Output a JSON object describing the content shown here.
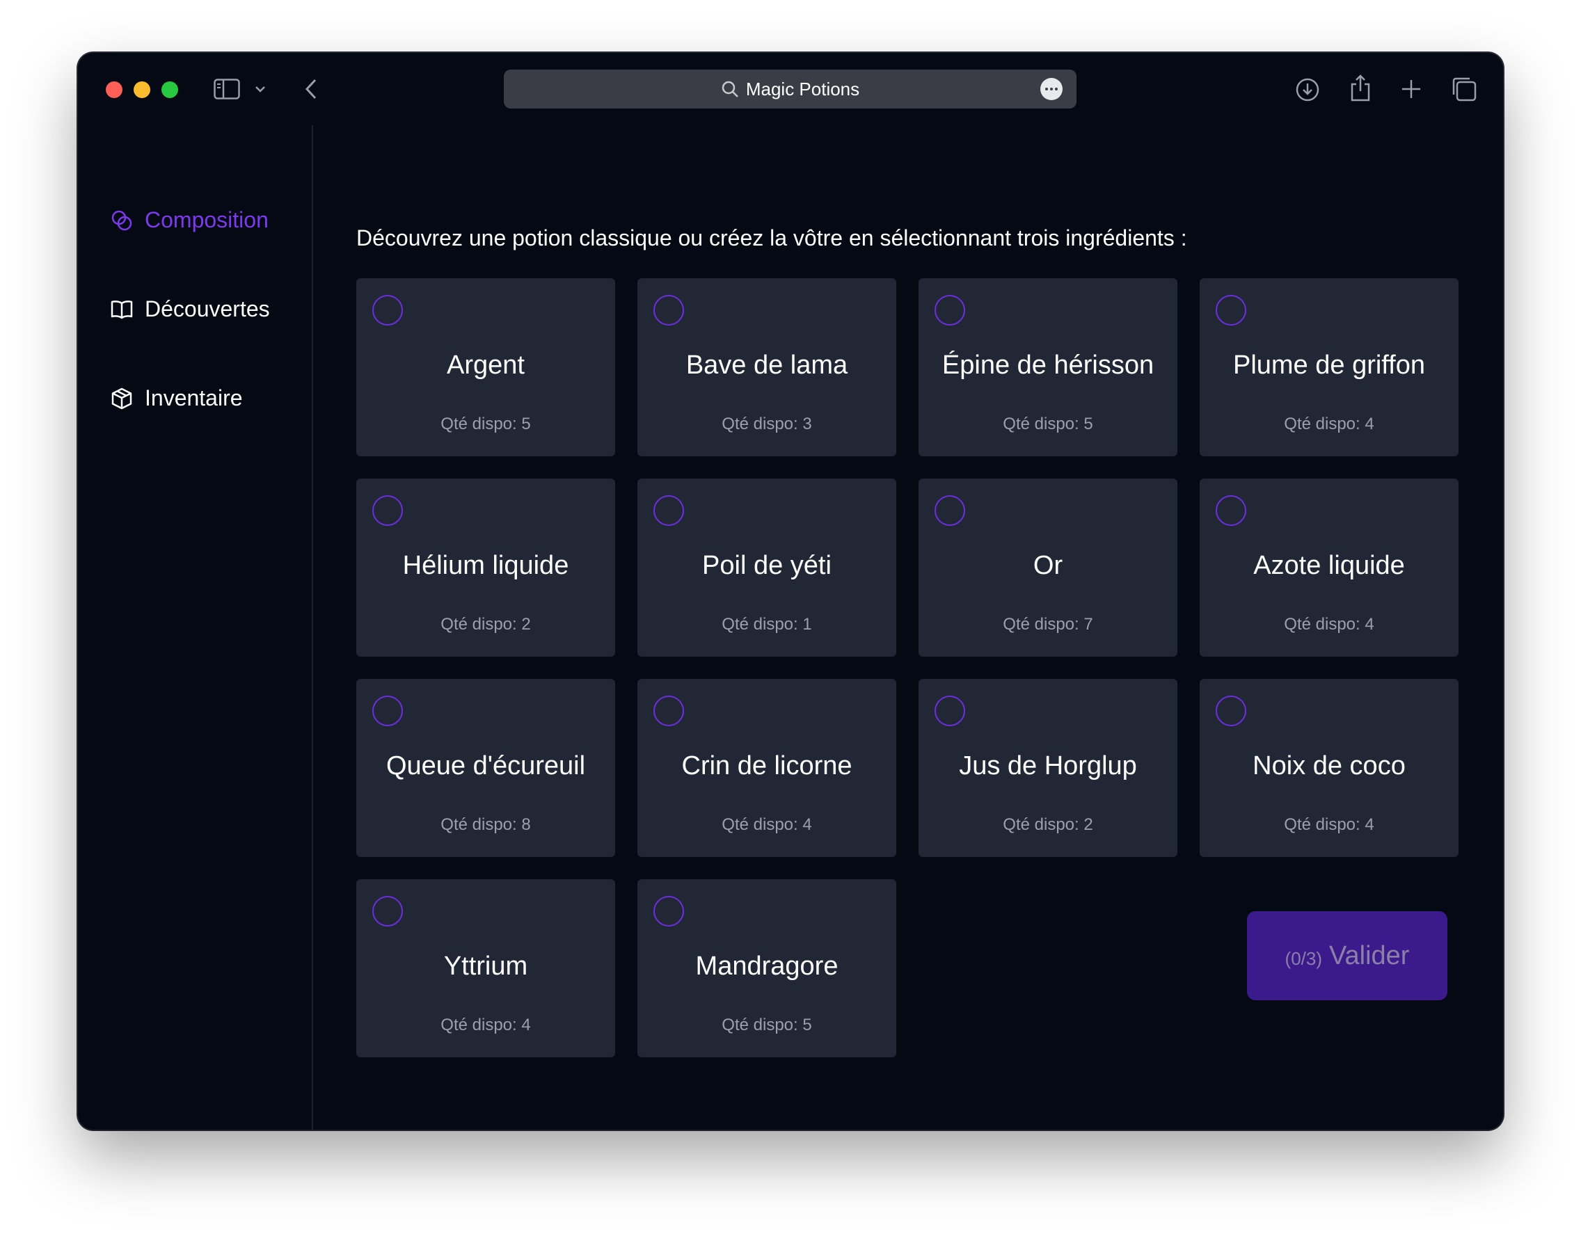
{
  "window": {
    "title": "Magic Potions"
  },
  "sidebar": {
    "items": [
      {
        "label": "Composition",
        "icon": "composition-icon",
        "active": true
      },
      {
        "label": "Découvertes",
        "icon": "book-icon",
        "active": false
      },
      {
        "label": "Inventaire",
        "icon": "box-icon",
        "active": false
      }
    ]
  },
  "main": {
    "intro": "Découvrez une potion classique ou créez la vôtre en sélectionnant trois ingrédients :",
    "ingredients": [
      {
        "name": "Argent",
        "qty": "Qté dispo: 5"
      },
      {
        "name": "Bave de lama",
        "qty": "Qté dispo: 3"
      },
      {
        "name": "Épine de hérisson",
        "qty": "Qté dispo: 5"
      },
      {
        "name": "Plume de griffon",
        "qty": "Qté dispo: 4"
      },
      {
        "name": "Hélium liquide",
        "qty": "Qté dispo: 2"
      },
      {
        "name": "Poil de yéti",
        "qty": "Qté dispo: 1"
      },
      {
        "name": "Or",
        "qty": "Qté dispo: 7"
      },
      {
        "name": "Azote liquide",
        "qty": "Qté dispo: 4"
      },
      {
        "name": "Queue d'écureuil",
        "qty": "Qté dispo: 8"
      },
      {
        "name": "Crin de licorne",
        "qty": "Qté dispo: 4"
      },
      {
        "name": "Jus de Horglup",
        "qty": "Qté dispo: 2"
      },
      {
        "name": "Noix de coco",
        "qty": "Qté dispo: 4"
      },
      {
        "name": "Yttrium",
        "qty": "Qté dispo: 4"
      },
      {
        "name": "Mandragore",
        "qty": "Qté dispo: 5"
      }
    ],
    "validate": {
      "count": "(0/3)",
      "label": "Valider"
    }
  },
  "colors": {
    "accent": "#7c3aed",
    "window_bg": "#050914",
    "card_bg": "#212734",
    "button_bg": "#3b1a8c"
  }
}
